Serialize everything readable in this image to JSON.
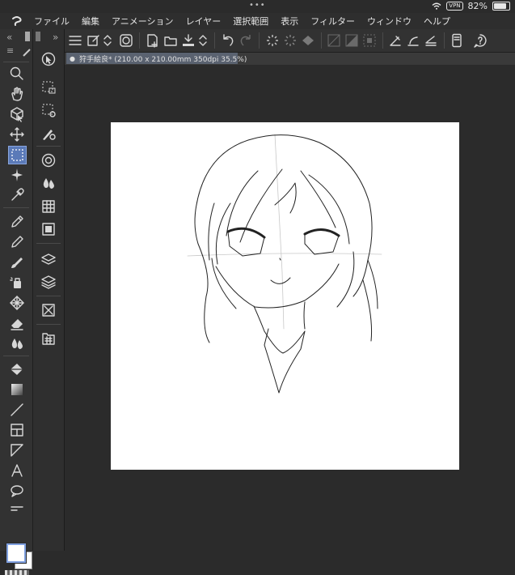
{
  "status_bar": {
    "battery": "82%",
    "vpn": "VPN",
    "indicator": "•••"
  },
  "menu": {
    "items": [
      "ファイル",
      "編集",
      "アニメーション",
      "レイヤー",
      "選択範囲",
      "表示",
      "フィルター",
      "ウィンドウ",
      "ヘルプ"
    ]
  },
  "panel_toggles": {
    "left_collapse": "«",
    "left_expand": "»"
  },
  "document": {
    "tab_label": "狩手絵良* (210.00 x 210.00mm 350dpi 35.5%)"
  },
  "tools": {
    "selected": "selection-rectangle"
  },
  "colors": {
    "accent": "#5b7ab8",
    "background": "#2b2b2b",
    "canvas": "#ffffff",
    "main_color": "#ffffff",
    "sub_color": "#ffffff"
  }
}
